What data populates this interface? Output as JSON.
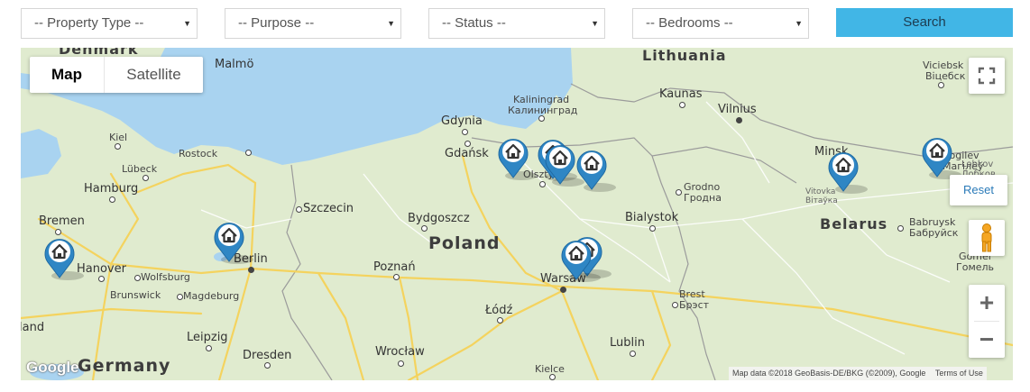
{
  "filters": {
    "property_type": "-- Property Type --",
    "purpose": "-- Purpose --",
    "status": "-- Status --",
    "bedrooms": "-- Bedrooms --",
    "search_label": "Search"
  },
  "map": {
    "type_map": "Map",
    "type_satellite": "Satellite",
    "reset_label": "Reset",
    "zoom_in": "+",
    "zoom_out": "−",
    "google_logo": "Google",
    "attribution": "Map data ©2018 GeoBasis-DE/BKG (©2009), Google",
    "terms": "Terms of Use",
    "countries": {
      "denmark": "Denmark",
      "lithuania": "Lithuania",
      "poland": "Poland",
      "belarus": "Belarus",
      "germany": "Germany"
    },
    "cities": {
      "malmo": "Malmö",
      "kaliningrad": "Kaliningrad",
      "kaliningrad_ru": "Калининград",
      "kaunas": "Kaunas",
      "vilnius": "Vilnius",
      "viciebsk": "Viciebsk",
      "viciebsk_ru": "Віцебск",
      "kiel": "Kiel",
      "gdynia": "Gdynia",
      "gdansk": "Gdańsk",
      "rostock": "Rostock",
      "lubeck": "Lübeck",
      "hamburg": "Hamburg",
      "olsztyn": "Olsztyn",
      "minsk": "Minsk",
      "mogilev": "Mogilev",
      "mogilev_ru": "Магілёў",
      "lobkov": "Lobkov",
      "lobkov_ru": "Лобков",
      "grodno": "Grodno",
      "grodno_ru": "Гродна",
      "vitovka": "Vitovka",
      "vitovka_ru": "Вітаўка",
      "bremen": "Bremen",
      "szczecin": "Szczecin",
      "bydgoszcz": "Bydgoszcz",
      "bialystok": "Bialystok",
      "babruysk": "Babruysk",
      "babruysk_ru": "Бабруйск",
      "berlin": "Berlin",
      "hanover": "Hanover",
      "wolfsburg": "Wolfsburg",
      "brunswick": "Brunswick",
      "magdeburg": "Magdeburg",
      "poznan": "Poznań",
      "warsaw": "Warsaw",
      "gomel": "Gomel",
      "gomel_ru": "Гомель",
      "brest": "Brest",
      "brest_ru": "Брэст",
      "lodz": "Łódź",
      "leipzig": "Leipzig",
      "dresden": "Dresden",
      "wroclaw": "Wrocław",
      "lublin": "Lublin",
      "kielce": "Kielce",
      "land": "land"
    }
  }
}
